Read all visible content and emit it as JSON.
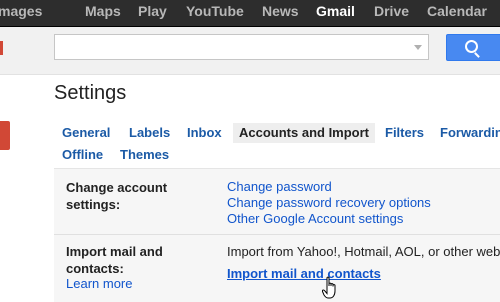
{
  "topbar": {
    "items": [
      {
        "label": "mages"
      },
      {
        "label": "Maps"
      },
      {
        "label": "Play"
      },
      {
        "label": "YouTube"
      },
      {
        "label": "News"
      },
      {
        "label": "Gmail"
      },
      {
        "label": "Drive"
      },
      {
        "label": "Calendar"
      }
    ],
    "active": "Gmail"
  },
  "search": {
    "value": "",
    "button_icon": "search-icon"
  },
  "page": {
    "title": "Settings"
  },
  "tabs": {
    "row1": [
      {
        "label": "General"
      },
      {
        "label": "Labels"
      },
      {
        "label": "Inbox"
      },
      {
        "label": "Accounts and Import"
      },
      {
        "label": "Filters"
      },
      {
        "label": "Forwardin"
      }
    ],
    "row2": [
      {
        "label": "Offline"
      },
      {
        "label": "Themes"
      }
    ],
    "selected": "Accounts and Import"
  },
  "sections": {
    "change_account": {
      "label_line1": "Change account",
      "label_line2": "settings:",
      "links": [
        {
          "label": "Change password"
        },
        {
          "label": "Change password recovery options"
        },
        {
          "label": "Other Google Account settings"
        }
      ]
    },
    "import_mail": {
      "label_line1": "Import mail and",
      "label_line2": "contacts:",
      "learn_more": "Learn more",
      "description": "Import from Yahoo!, Hotmail, AOL, or other web",
      "action_link": "Import mail and contacts"
    }
  },
  "colors": {
    "topbar_bg": "#2d2d2d",
    "link": "#1155cc",
    "tab_link": "#1b5aa6",
    "accent_red": "#d14836",
    "search_blue": "#4889f1"
  }
}
